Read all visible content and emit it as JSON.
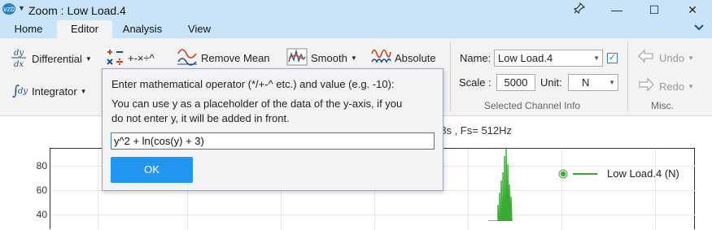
{
  "window": {
    "title": "Zoom : Low Load.4",
    "app_icon_text": "vzb",
    "qa_dropdown": "▼",
    "pin": "✎",
    "minimize": "—",
    "maximize": "☐",
    "close": "✕"
  },
  "tabs": [
    {
      "label": "Home",
      "active": false
    },
    {
      "label": "Editor",
      "active": true
    },
    {
      "label": "Analysis",
      "active": false
    },
    {
      "label": "View",
      "active": false
    }
  ],
  "ribbon": {
    "differential": "Differential",
    "integrator": "Integrator",
    "math_ops": "+-×÷^",
    "remove_mean": "Remove Mean",
    "smooth": "Smooth",
    "absolute": "Absolute",
    "name_label": "Name:",
    "name_value": "Low Load.4",
    "scale_label": "Scale :",
    "scale_value": "5000",
    "unit_label": "Unit:",
    "unit_value": "N",
    "group_channel": "Selected Channel Info",
    "undo": "Undo",
    "redo": "Redo",
    "group_misc": "Misc.",
    "accent": "#2196f3"
  },
  "chart": {
    "title_fragment": "18s , Fs= 512Hz",
    "legend_label": "Low Load.4 (N)",
    "series_color": "#3aaa35",
    "y_ticks": [
      "80",
      "60",
      "40"
    ]
  },
  "chart_data": {
    "type": "line",
    "title": "18s , Fs= 512Hz",
    "series": [
      {
        "name": "Low Load.4 (N)"
      }
    ],
    "y_ticks": [
      80,
      60,
      40
    ]
  },
  "dialog": {
    "line1": "Enter mathematical operator (*/+-^ etc.) and value (e.g. -10):",
    "line2": "You can use y as a placeholder of the data of the y-axis, if you",
    "line3": "do not enter y, it will be added in front.",
    "input_value": "y^2 + ln(cos(y) + 3)",
    "ok_label": "OK"
  }
}
